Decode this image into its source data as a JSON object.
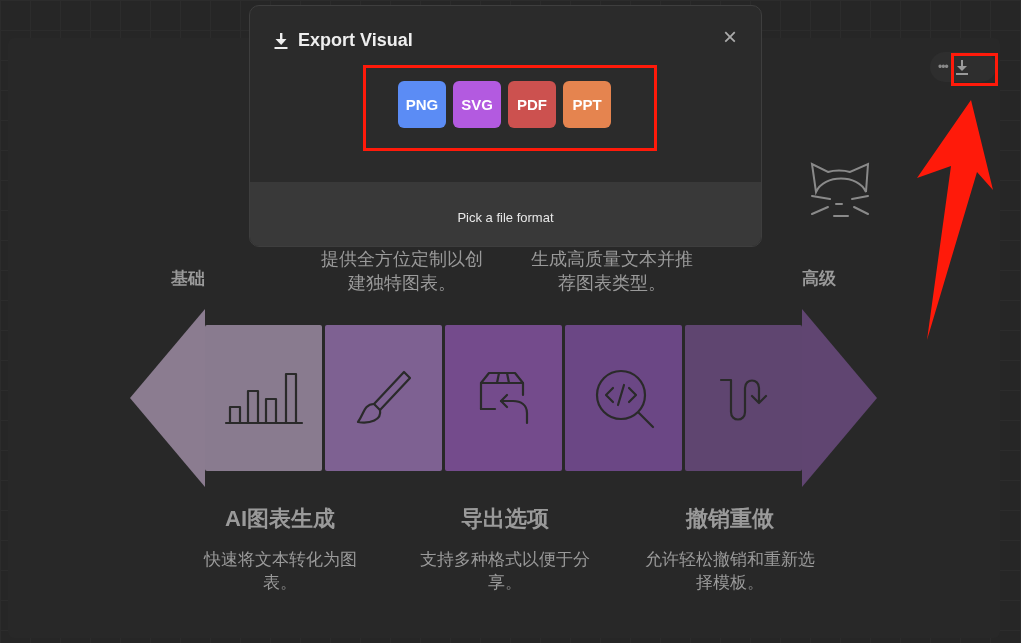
{
  "diagram": {
    "left_label": "基础",
    "right_label": "高级",
    "top_notes": [
      "提供全方位定制以创建独特图表。",
      "生成高质量文本并推荐图表类型。"
    ],
    "segments": [
      {
        "kind": "chart",
        "color": "#897b8f"
      },
      {
        "kind": "brush",
        "color": "#7e6192"
      },
      {
        "kind": "export",
        "color": "#744b8c"
      },
      {
        "kind": "code",
        "color": "#6b4785"
      },
      {
        "kind": "undo",
        "color": "#5f4570"
      }
    ],
    "features": [
      {
        "title": "AI图表生成",
        "description": "快速将文本转化为图表。"
      },
      {
        "title": "导出选项",
        "description": "支持多种格式以便于分享。"
      },
      {
        "title": "撤销重做",
        "description": "允许轻松撤销和重新选择模板。"
      }
    ]
  },
  "toolbar": {
    "more": "•••"
  },
  "modal": {
    "title": "Export Visual",
    "close": "×",
    "formats": [
      {
        "label": "PNG",
        "color": "#5b8cf5"
      },
      {
        "label": "SVG",
        "color": "#b35ae0"
      },
      {
        "label": "PDF",
        "color": "#cc514f"
      },
      {
        "label": "PPT",
        "color": "#e5844f"
      }
    ],
    "hint": "Pick a file format"
  }
}
